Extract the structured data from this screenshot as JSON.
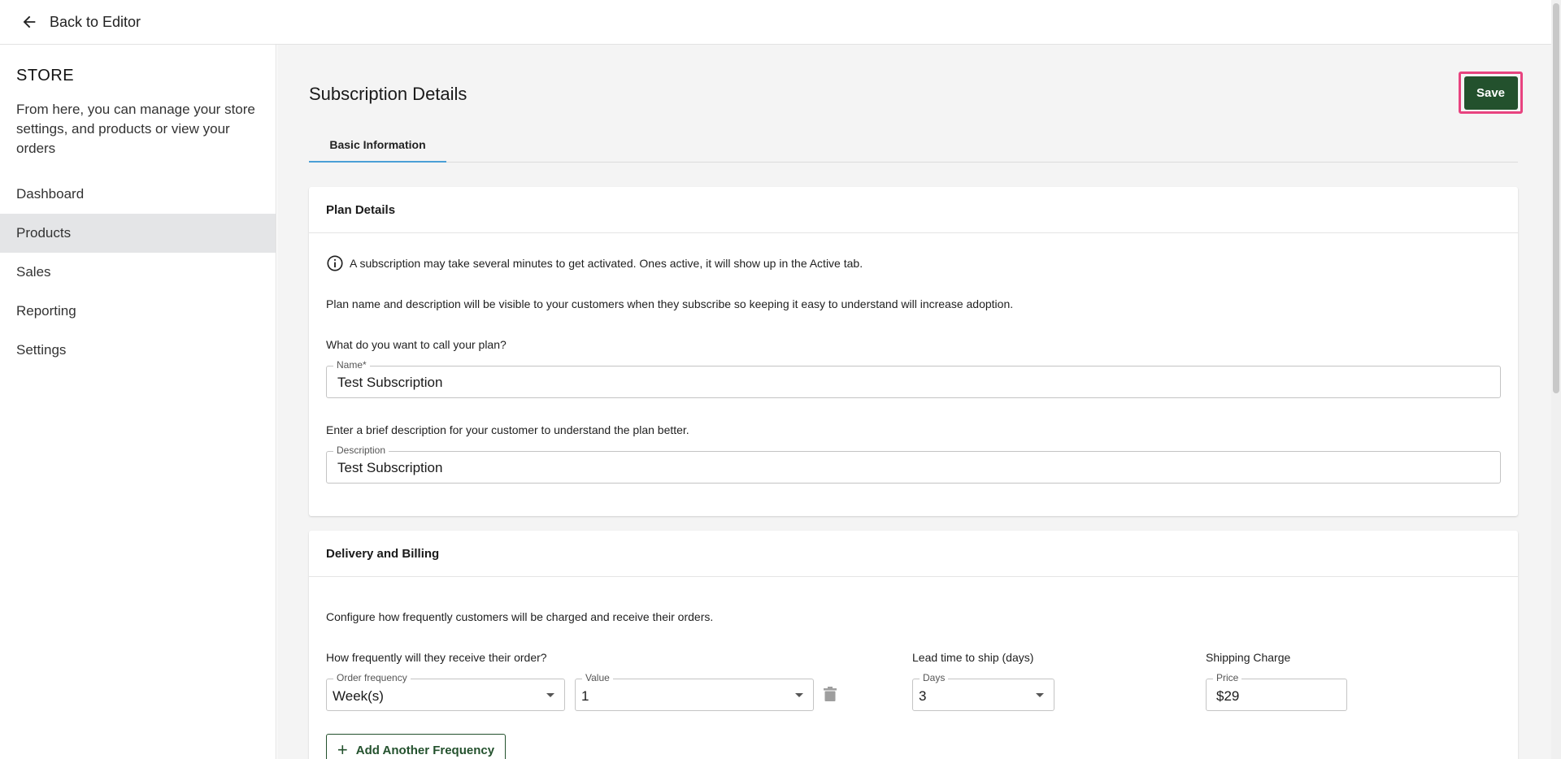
{
  "topbar": {
    "back_label": "Back to Editor",
    "back_icon": "arrow-left-icon"
  },
  "sidebar": {
    "title": "STORE",
    "description": "From here, you can manage your store settings, and products or view your orders",
    "items": [
      {
        "label": "Dashboard",
        "active": false
      },
      {
        "label": "Products",
        "active": true
      },
      {
        "label": "Sales",
        "active": false
      },
      {
        "label": "Reporting",
        "active": false
      },
      {
        "label": "Settings",
        "active": false
      }
    ]
  },
  "main": {
    "title": "Subscription Details",
    "save_label": "Save",
    "tabs": [
      {
        "label": "Basic Information",
        "active": true
      }
    ]
  },
  "plan_details": {
    "heading": "Plan Details",
    "info_text": "A subscription may take several minutes to get activated. Ones active, it will show up in the Active tab.",
    "visibility_text": "Plan name and description will be visible to your customers when they subscribe so keeping it easy to understand will increase adoption.",
    "name_prompt": "What do you want to call your plan?",
    "name_label": "Name*",
    "name_value": "Test Subscription",
    "description_prompt": "Enter a brief description for your customer to understand the plan better.",
    "description_label": "Description",
    "description_value": "Test Subscription"
  },
  "delivery_billing": {
    "heading": "Delivery and Billing",
    "intro": "Configure how frequently customers will be charged and receive their orders.",
    "frequency_prompt": "How frequently will they receive their order?",
    "order_frequency_label": "Order frequency",
    "order_frequency_value": "Week(s)",
    "value_label": "Value",
    "value_value": "1",
    "lead_time_prompt": "Lead time to ship (days)",
    "days_label": "Days",
    "days_value": "3",
    "shipping_prompt": "Shipping Charge",
    "price_label": "Price",
    "price_value": "$29",
    "add_frequency_label": "Add Another Frequency"
  },
  "colors": {
    "primary": "#23512d",
    "highlight": "#e8437f",
    "tab_underline": "#4a9fd6",
    "active_nav": "#e4e5e7"
  }
}
